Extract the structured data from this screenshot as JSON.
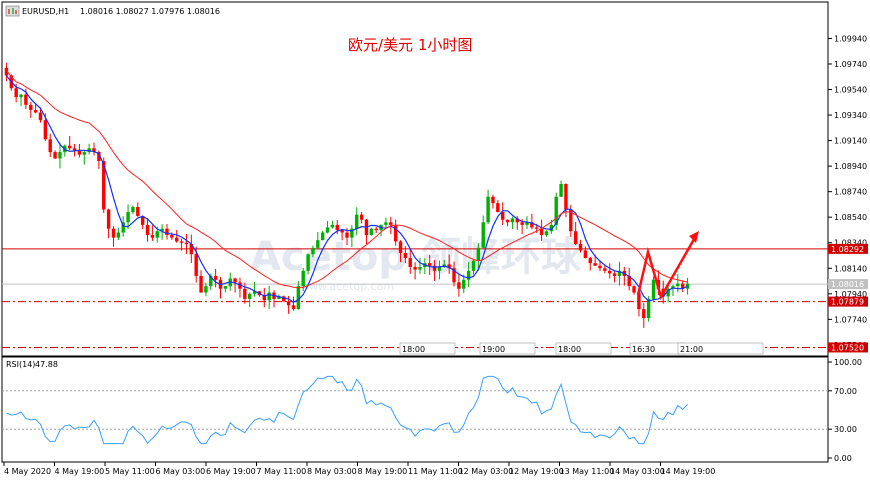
{
  "header": {
    "symbol": "EURUSD,H1",
    "ohlc": "1.08016 1.08027 1.07976 1.08016"
  },
  "chart_title": "欧元/美元 1小时图",
  "watermark": {
    "main": "Acetop 领峰环球",
    "url": "www.acetop.com"
  },
  "chart_data": {
    "type": "candlestick",
    "symbol": "EURUSD",
    "timeframe": "H1",
    "ylim": [
      1.075,
      1.101
    ],
    "y_ticks": [
      "1.09940",
      "1.09740",
      "1.09540",
      "1.09340",
      "1.09140",
      "1.08940",
      "1.08740",
      "1.08540",
      "1.08340",
      "1.08140",
      "1.07940",
      "1.07740",
      "1.07540"
    ],
    "x_ticks": [
      "4 May 2020",
      "4 May 19:00",
      "5 May 11:00",
      "6 May 03:00",
      "6 May 19:00",
      "7 May 11:00",
      "8 May 03:00",
      "8 May 19:00",
      "11 May 11:00",
      "12 May 03:00",
      "12 May 19:00",
      "13 May 11:00",
      "14 May 03:00",
      "14 May 19:00"
    ],
    "horizontal_lines": [
      {
        "price": 1.08292,
        "label": "1.08292",
        "style": "solid",
        "color": "#d00000"
      },
      {
        "price": 1.08016,
        "label": "1.08016",
        "style": "solid",
        "color": "#c0c0c0"
      },
      {
        "price": 1.07879,
        "label": "1.07879",
        "style": "dashdot",
        "color": "#d00000"
      },
      {
        "price": 1.0752,
        "label": "1.07520",
        "style": "dashdot",
        "color": "#d00000"
      }
    ],
    "close_path": [
      1.0965,
      1.0955,
      1.0948,
      1.095,
      1.0942,
      1.0938,
      1.0936,
      1.093,
      1.0915,
      1.0905,
      1.09,
      1.0905,
      1.091,
      1.0908,
      1.0906,
      1.0903,
      1.0905,
      1.0908,
      1.0905,
      1.0898,
      1.086,
      1.0845,
      1.0838,
      1.0842,
      1.085,
      1.0858,
      1.0862,
      1.0855,
      1.0848,
      1.084,
      1.0838,
      1.0843,
      1.0845,
      1.084,
      1.0838,
      1.0835,
      1.0834,
      1.0833,
      1.0825,
      1.0808,
      1.0795,
      1.08,
      1.0808,
      1.0805,
      1.0798,
      1.08,
      1.0806,
      1.0803,
      1.0798,
      1.079,
      1.0794,
      1.0796,
      1.0793,
      1.0789,
      1.0795,
      1.079,
      1.0792,
      1.0788,
      1.0785,
      1.0782,
      1.08,
      1.0812,
      1.0825,
      1.083,
      1.0836,
      1.0842,
      1.0846,
      1.0848,
      1.0844,
      1.0842,
      1.0838,
      1.0845,
      1.0856,
      1.0852,
      1.084,
      1.0845,
      1.0844,
      1.0848,
      1.085,
      1.0848,
      1.0835,
      1.0826,
      1.0822,
      1.0815,
      1.0813,
      1.0815,
      1.0818,
      1.0816,
      1.0812,
      1.0815,
      1.0817,
      1.0814,
      1.0803,
      1.0798,
      1.0805,
      1.0812,
      1.082,
      1.083,
      1.085,
      1.087,
      1.0865,
      1.0858,
      1.0852,
      1.085,
      1.0853,
      1.085,
      1.0848,
      1.085,
      1.0846,
      1.0845,
      1.084,
      1.0843,
      1.0848,
      1.087,
      1.088,
      1.086,
      1.0843,
      1.0833,
      1.0828,
      1.0822,
      1.0818,
      1.0816,
      1.0814,
      1.0812,
      1.081,
      1.0808,
      1.0812,
      1.0808,
      1.08,
      1.0795,
      1.0782,
      1.0775,
      1.079,
      1.0805,
      1.0798,
      1.0792,
      1.0798,
      1.08,
      1.0802,
      1.0798,
      1.0802
    ],
    "ma_fast": "blue",
    "ma_slow": "red",
    "indicator": {
      "name": "RSI(14)",
      "value_label": "47.88",
      "ylim": [
        0,
        100
      ],
      "levels": [
        70,
        30
      ],
      "y_ticks": [
        "100.00",
        "70.00",
        "30.00",
        "0.00"
      ]
    },
    "annotation_arrow": "red zigzag arrow pointing up-right at the end of the chart"
  },
  "colors": {
    "bull": "#00b000",
    "bear": "#ff0000",
    "ma_fast": "#1030ff",
    "ma_slow": "#ff2020",
    "rsi": "#3aa0ff"
  }
}
